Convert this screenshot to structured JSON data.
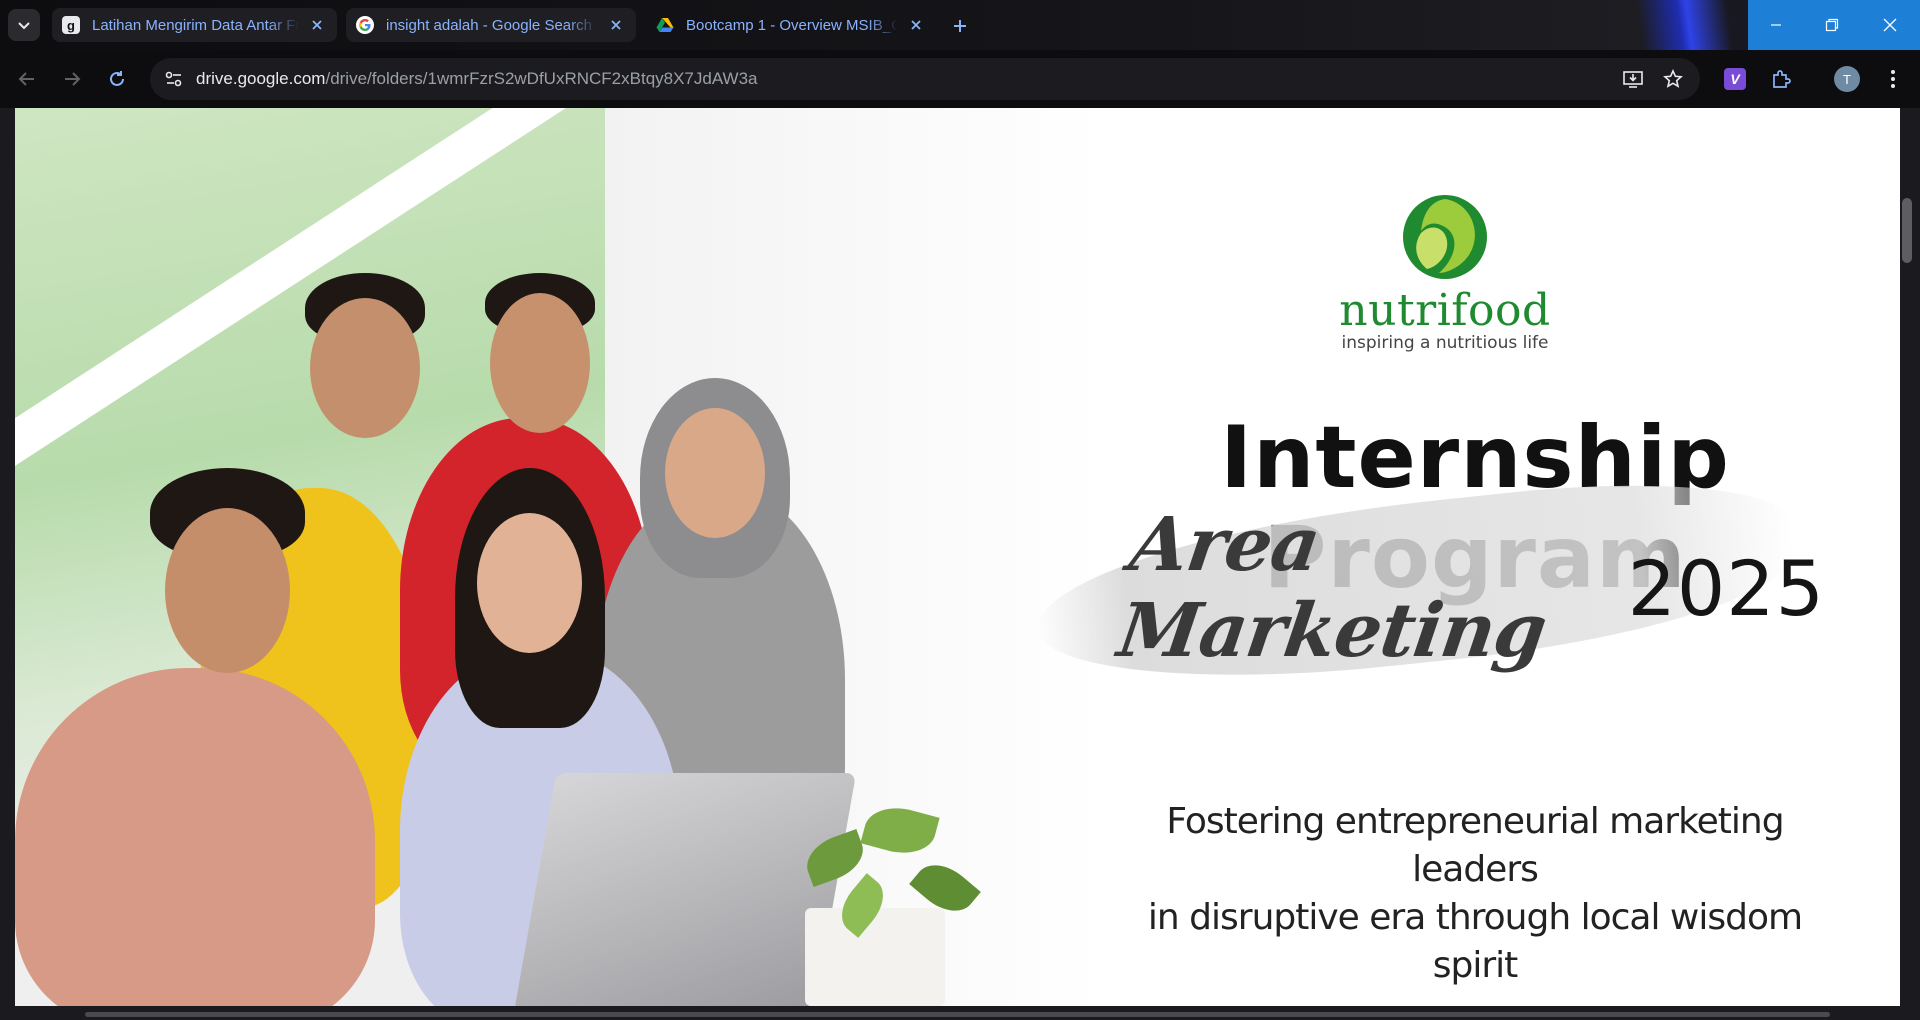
{
  "browser": {
    "tabs": [
      {
        "title": "Latihan Mengirim Data Antar Fr",
        "favicon": "g-badge-icon",
        "active": false
      },
      {
        "title": "insight adalah - Google Search",
        "favicon": "google-icon",
        "active": false
      },
      {
        "title": "Bootcamp 1 - Overview MSIB_C",
        "favicon": "google-drive-icon",
        "active": true
      }
    ],
    "omnibox": {
      "host": "drive.google.com",
      "path": "/drive/folders/1wmrFzrS2wDfUxRNCF2xBtqy8X7JdAW3a"
    },
    "profile_initial": "T",
    "extension_label": "V",
    "colors": {
      "accent": "#1d7fd6",
      "tab_text": "#8ab4f8",
      "toolbar_bg": "#0d0d10"
    }
  },
  "banner": {
    "logo": {
      "word": "nutrifood",
      "tagline": "inspiring a nutritious life",
      "color": "#1f8a2f"
    },
    "headline": "Internship Program",
    "area_script": "Area Marketing",
    "year": "2025",
    "tagline_line1": "Fostering entrepreneurial marketing leaders",
    "tagline_line2": "in disruptive era through local wisdom spirit"
  }
}
